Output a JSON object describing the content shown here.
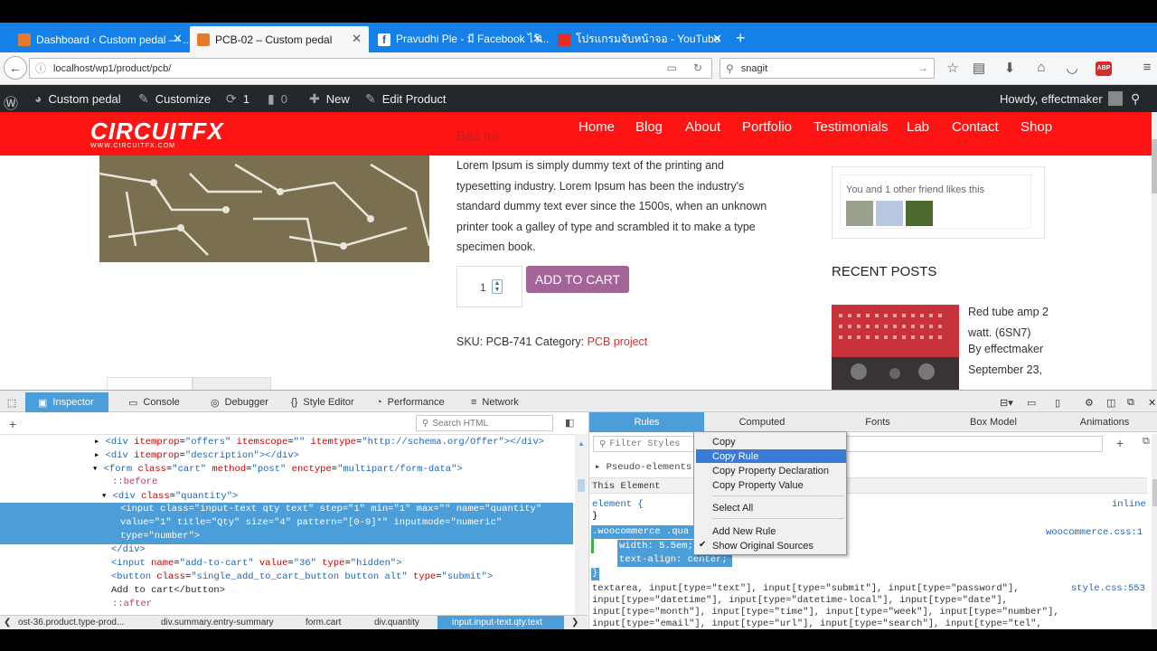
{
  "browser": {
    "tabs": [
      {
        "title": "Dashboard ‹ Custom pedal — ...",
        "icon": "wordpress-icon"
      },
      {
        "title": "PCB-02 – Custom pedal",
        "icon": "wordpress-icon"
      },
      {
        "title": "Pravudhi Ple - มี Facebook ไว้เ...",
        "icon": "facebook-icon"
      },
      {
        "title": "โปรแกรมจับหน้าจอ - YouTube",
        "icon": "youtube-icon"
      }
    ],
    "close_glyph": "✕",
    "new_tab": "+",
    "url": "localhost/wp1/product/pcb/",
    "search": "snagit",
    "addon_badge": "ABP"
  },
  "wp_admin_bar": {
    "site": "Custom pedal",
    "customize": "Customize",
    "updates": "1",
    "comments": "0",
    "new": "New",
    "edit": "Edit Product",
    "howdy": "Howdy, effectmaker"
  },
  "site": {
    "logo": "CIRCUITFX",
    "logo_sub": "WWW.CIRCUITFX.COM",
    "menu": [
      "Home",
      "Blog",
      "About",
      "Portfolio",
      "Testimonials",
      "Lab",
      "Contact",
      "Shop"
    ],
    "heading_partial": "Bas no",
    "description": "Lorem Ipsum is simply dummy text of the printing and typesetting industry. Lorem Ipsum has been the industry's standard dummy text ever since the 1500s, when an unknown printer took a galley of type and scrambled it to make a type specimen book.",
    "quantity": "1",
    "add_to_cart": "ADD TO CART",
    "sku_label": "SKU:",
    "sku": "PCB-741",
    "category_label": "Category:",
    "category": "PCB project",
    "fb_likes": "You and 1 other friend likes this",
    "recent_posts_title": "RECENT POSTS",
    "post_title": "Red tube amp 2 watt. (6SN7)",
    "post_author": "By effectmaker",
    "post_date": "September 23,"
  },
  "devtools": {
    "tabs": [
      "Inspector",
      "Console",
      "Debugger",
      "Style Editor",
      "Performance",
      "Network"
    ],
    "search_placeholder": "Search HTML",
    "side_tabs": [
      "Rules",
      "Computed",
      "Fonts",
      "Box Model",
      "Animations"
    ],
    "filter_placeholder": "Filter Styles",
    "pseudo_elements": "Pseudo-elements",
    "this_element": "This Element",
    "element_rule": "element {",
    "close_brace": "}",
    "inline": "inline",
    "rule_selector": ".woocommerce .qua",
    "rule_source": "woocommerce.css:1",
    "rule_decl1": "width: 5.5em;",
    "rule_decl2": "text-align: center;",
    "style_source": "style.css:553",
    "style_lines": [
      "textarea, input[type=\"text\"], input[type=\"submit\"], input[type=\"password\"],",
      "input[type=\"datetime\"], input[type=\"datetime-local\"], input[type=\"date\"],",
      "input[type=\"month\"], input[type=\"time\"], input[type=\"week\"], input[type=\"number\"],",
      "input[type=\"email\"], input[type=\"url\"], input[type=\"search\"], input[type=\"tel\","
    ],
    "context_menu": [
      "Copy",
      "Copy Rule",
      "Copy Property Declaration",
      "Copy Property Value",
      "Select All",
      "Add New Rule",
      "Show Original Sources"
    ],
    "breadcrumbs": [
      "ost-36.product.type-prod...",
      "div.summary.entry-summary",
      "form.cart",
      "div.quantity",
      "input.input-text.qty.text"
    ],
    "html_lines": {
      "l1": "<div itemprop=\"offers\" itemscope=\"\" itemtype=\"http://schema.org/Offer\"></div>",
      "l2": "<div itemprop=\"description\"></div>",
      "l3": "<form class=\"cart\" method=\"post\" enctype=\"multipart/form-data\">",
      "l4": "::before",
      "l5": "<div class=\"quantity\">",
      "l6": "<input class=\"input-text qty text\" step=\"1\" min=\"1\" max=\"\" name=\"quantity\"",
      "l7": "value=\"1\" title=\"Qty\" size=\"4\" pattern=\"[0-9]*\" inputmode=\"numeric\"",
      "l8": "type=\"number\">",
      "l9": "</div>",
      "l10": "<input name=\"add-to-cart\" value=\"36\" type=\"hidden\">",
      "l11": "<button class=\"single_add_to_cart_button button alt\" type=\"submit\">",
      "l12": "Add to cart</button>",
      "l13": "::after"
    }
  },
  "colors": {
    "tabbar": "#1580e8",
    "site_red": "#ff1414",
    "add_to_cart": "#a36597",
    "selection": "#4c9ed9",
    "wpbar": "#23282d"
  }
}
